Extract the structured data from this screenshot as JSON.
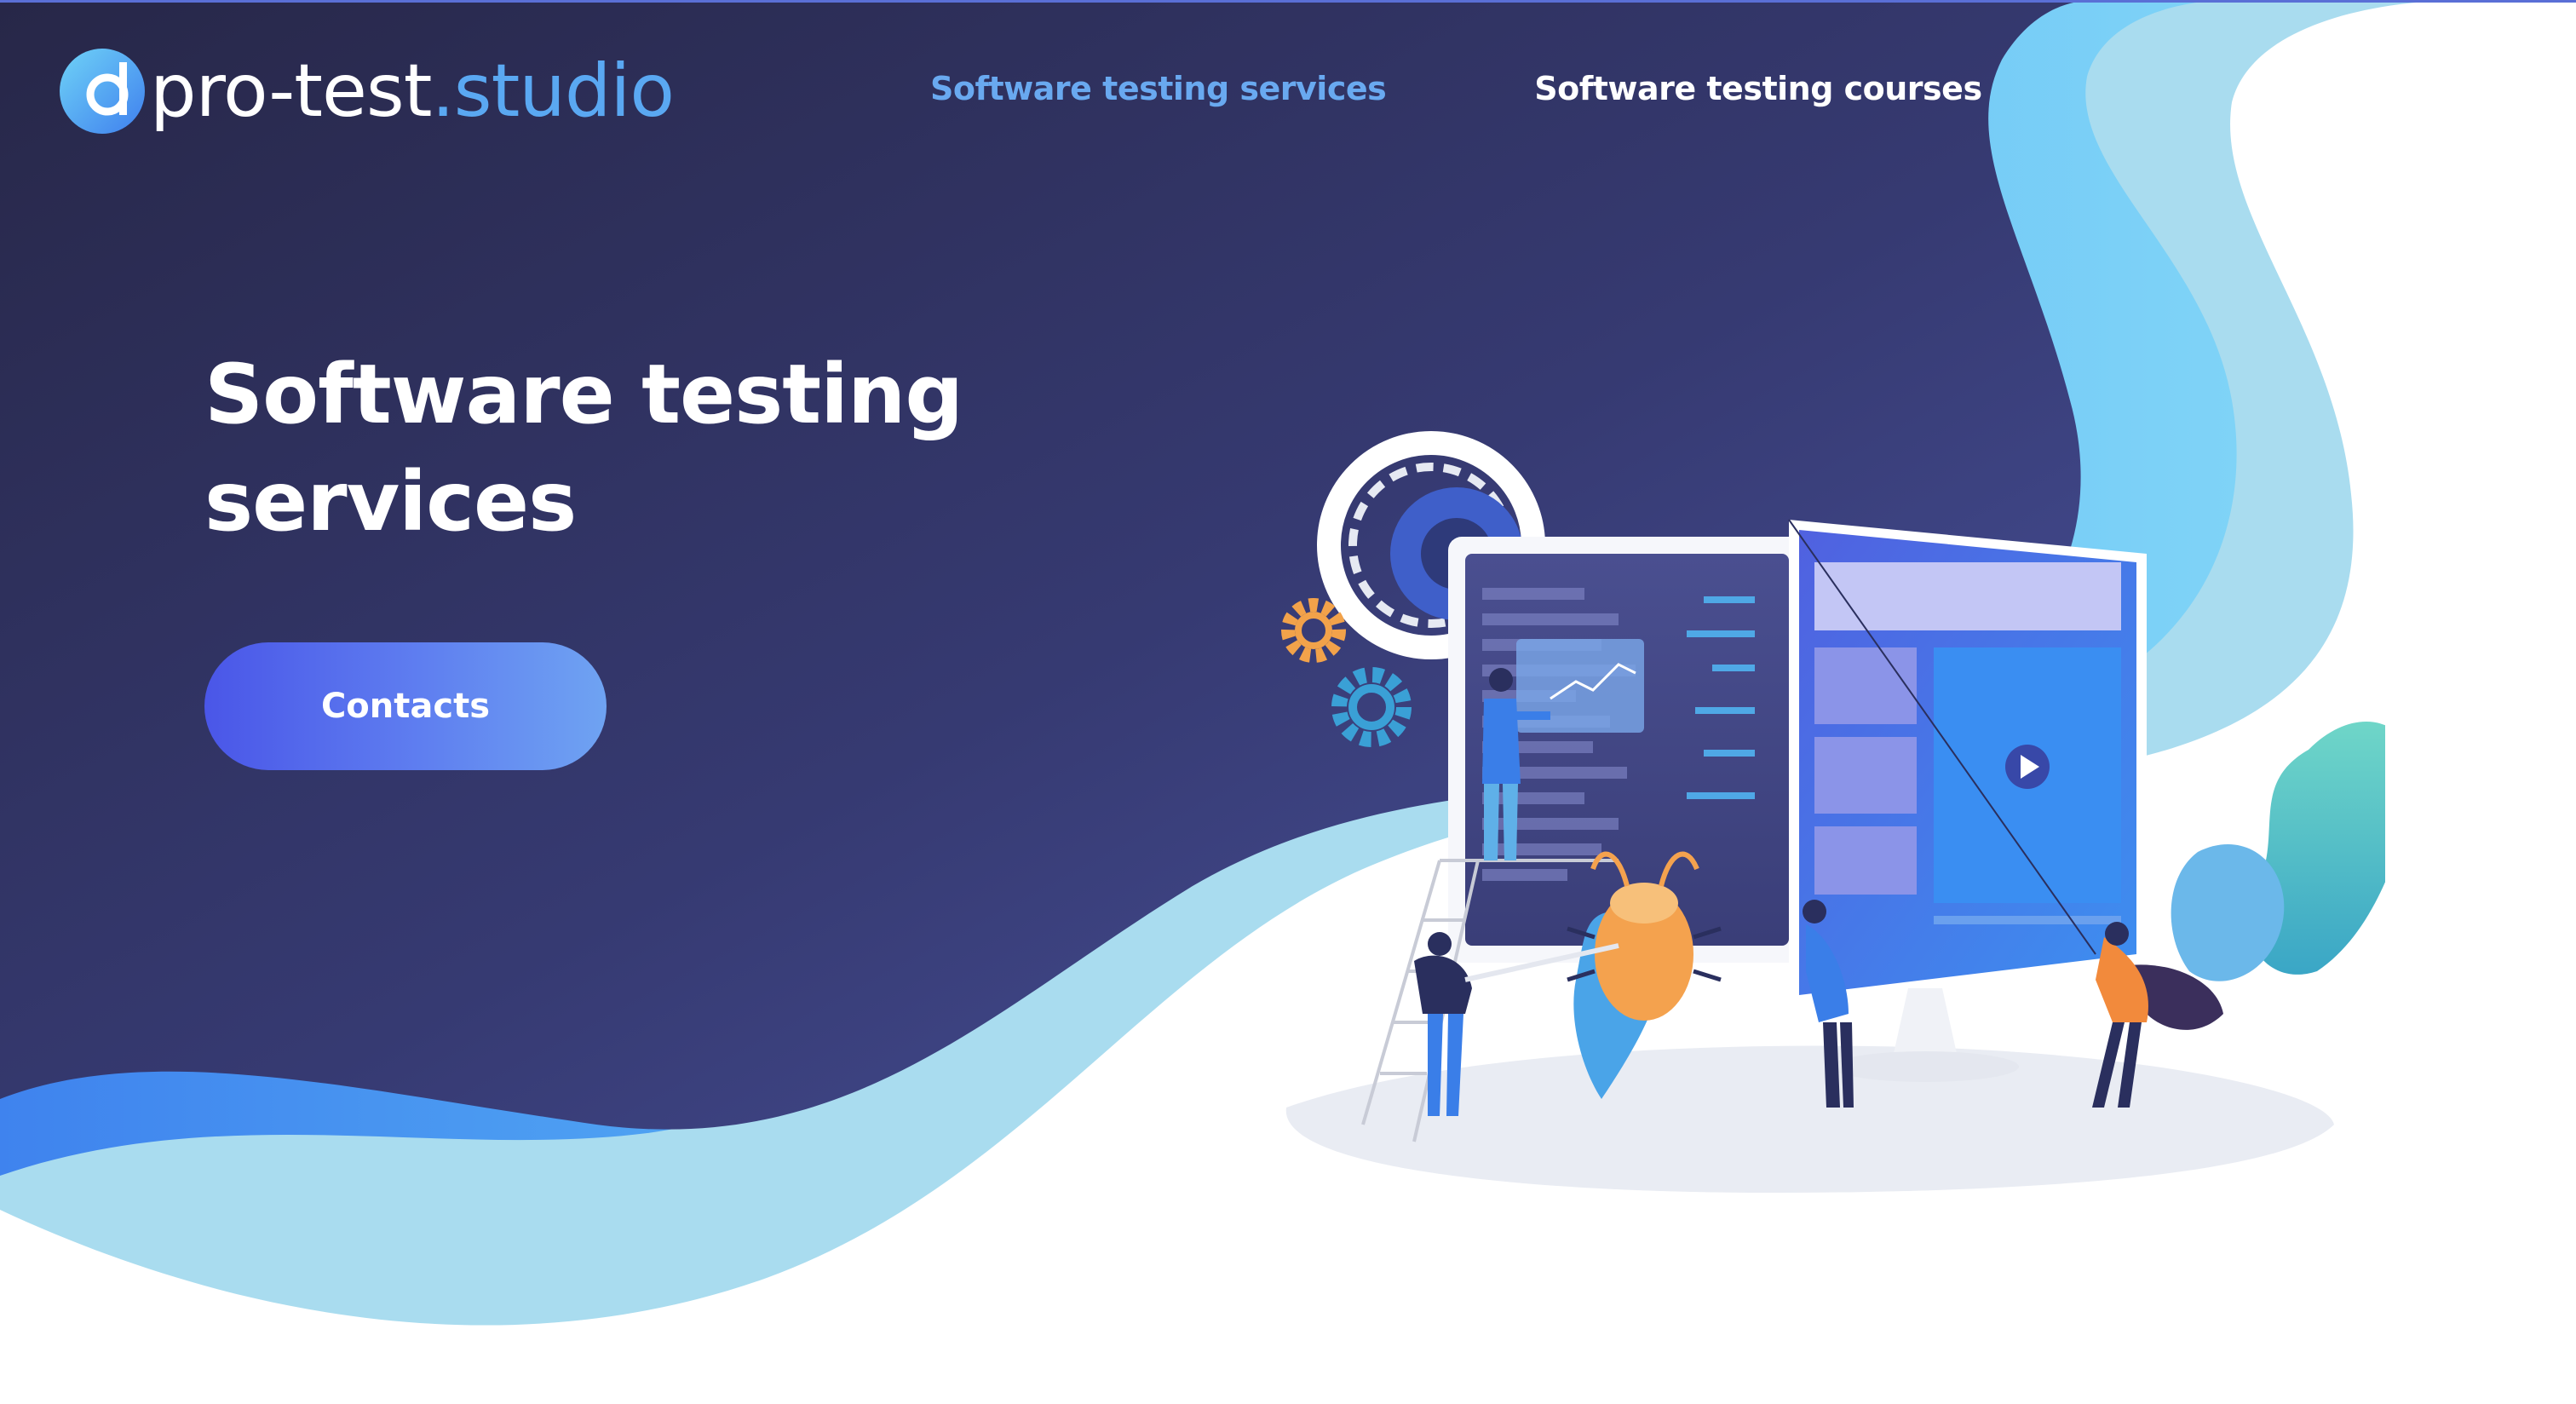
{
  "brand": {
    "name_part1": "pro-test",
    "name_part2": ".studio",
    "logo_icon": "brand-circle-logo"
  },
  "nav": {
    "items": [
      {
        "label": "Software testing services",
        "active": true
      },
      {
        "label": "Software testing courses",
        "active": false
      }
    ]
  },
  "hero": {
    "title": "Software testing services",
    "cta_label": "Contacts"
  },
  "illustration": {
    "description_icons": [
      "gear-icon",
      "monitor-icon",
      "bug-icon",
      "play-icon",
      "person-icon",
      "plant-icon"
    ]
  },
  "colors": {
    "background_dark": "#2a2a54",
    "background_mid": "#414887",
    "wave_blue": "#5aa8f2",
    "wave_light": "#a9dcf0",
    "accent_nav": "#69a9f0",
    "button_start": "#4a56e8",
    "button_end": "#6fa3f2",
    "bug_orange": "#f4a24e",
    "plant_teal": "#5fc9c4"
  }
}
